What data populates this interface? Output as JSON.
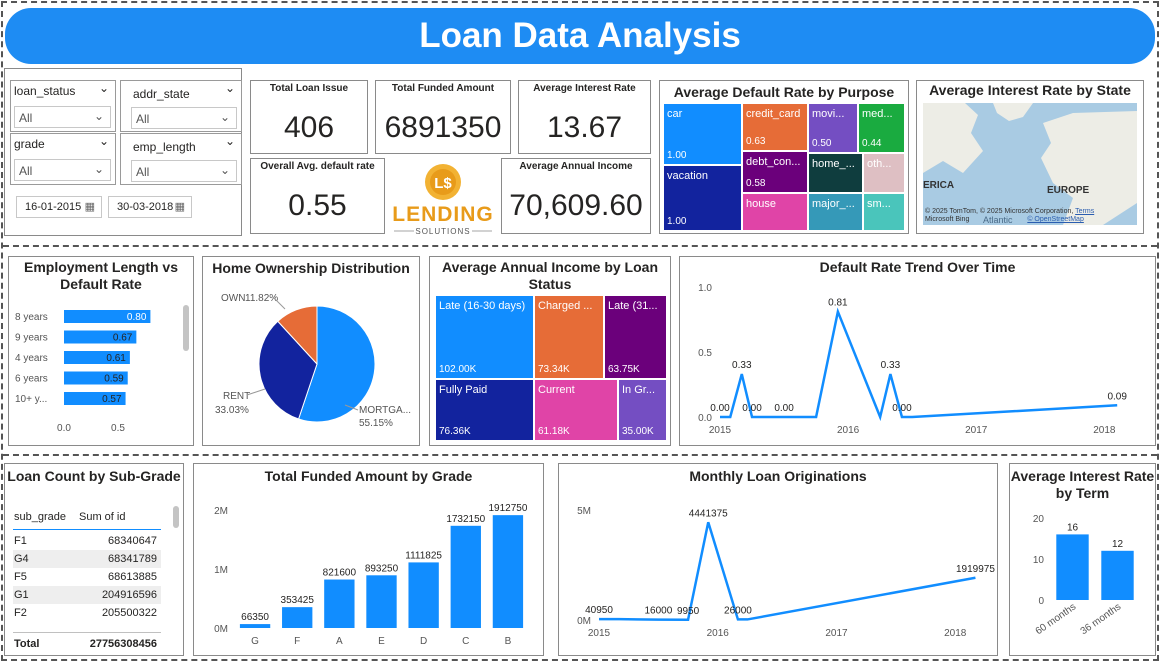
{
  "header": {
    "title": "Loan Data Analysis"
  },
  "slicers": {
    "loan_status": {
      "label": "loan_status",
      "value": "All"
    },
    "addr_state": {
      "label": "addr_state",
      "value": "All"
    },
    "grade": {
      "label": "grade",
      "value": "All"
    },
    "emp_length": {
      "label": "emp_length",
      "value": "All"
    },
    "date_from": "16-01-2015",
    "date_to": "30-03-2018"
  },
  "kpis": {
    "total_loan_issue": {
      "label": "Total Loan Issue",
      "value": "406"
    },
    "total_funded": {
      "label": "Total Funded Amount",
      "value": "6891350"
    },
    "avg_interest": {
      "label": "Average Interest Rate",
      "value": "13.67"
    },
    "overall_default": {
      "label": "Overall Avg. default rate",
      "value": "0.55"
    },
    "avg_income": {
      "label": "Average Annual Income",
      "value": "70,609.60"
    }
  },
  "logo": {
    "text": "LENDING",
    "sub": "SOLUTIONS",
    "symbol": "L$"
  },
  "map": {
    "title": "Average Interest Rate by State",
    "labels": [
      "ERICA",
      "EUROPE",
      "Atlantic"
    ],
    "attribution_1": "© 2025 TomTom, © 2025 Microsoft Corporation,",
    "attribution_link": "Terms",
    "attribution_2": "© OpenStreetMap",
    "bing": "Microsoft Bing"
  },
  "colors": {
    "accent": "#118DFF",
    "header": "#1E8CF3",
    "pie_mortgage": "#118DFF",
    "pie_rent": "#12239E",
    "pie_own": "#E66C37"
  },
  "chart_data": [
    {
      "id": "default_by_purpose",
      "type": "treemap",
      "title": "Average Default Rate by Purpose",
      "items": [
        {
          "label": "car",
          "value": "1.00",
          "color": "#118DFF"
        },
        {
          "label": "vacation",
          "value": "1.00",
          "color": "#12239E"
        },
        {
          "label": "credit_card",
          "value": "0.63",
          "color": "#E66C37"
        },
        {
          "label": "debt_con...",
          "value": "0.58",
          "color": "#6B007B"
        },
        {
          "label": "house",
          "value": "",
          "color": "#E044A7"
        },
        {
          "label": "movi...",
          "value": "0.50",
          "color": "#744EC2"
        },
        {
          "label": "med...",
          "value": "0.44",
          "color": "#1AAB40"
        },
        {
          "label": "home_...",
          "value": "",
          "color": "#0F3D3E"
        },
        {
          "label": "oth...",
          "value": "",
          "color": "#DEBFC3"
        },
        {
          "label": "major_...",
          "value": "",
          "color": "#3599B8"
        },
        {
          "label": "sm...",
          "value": "",
          "color": "#4AC5BB"
        }
      ]
    },
    {
      "id": "emp_length_default",
      "type": "bar",
      "orientation": "horizontal",
      "title": "Employment Length vs Default Rate",
      "categories": [
        "8 years",
        "9 years",
        "4 years",
        "6 years",
        "10+ y..."
      ],
      "values": [
        0.8,
        0.67,
        0.61,
        0.59,
        0.57
      ],
      "value_labels": [
        "0.80",
        "0.67",
        "0.61",
        "0.59",
        "0.57"
      ],
      "xticks": [
        "0.0",
        "0.5"
      ],
      "xlim": [
        0,
        1
      ]
    },
    {
      "id": "home_ownership",
      "type": "pie",
      "title": "Home Ownership Distribution",
      "slices": [
        {
          "label": "MORTGA...",
          "value": 55.15,
          "pct_label": "55.15%"
        },
        {
          "label": "RENT",
          "value": 33.03,
          "pct_label": "33.03%"
        },
        {
          "label": "OWN",
          "value": 11.82,
          "pct_label": "11.82%"
        }
      ]
    },
    {
      "id": "income_by_status",
      "type": "treemap",
      "title": "Average Annual Income by Loan Status",
      "items": [
        {
          "label": "Late (16-30 days)",
          "value": "102.00K",
          "color": "#118DFF"
        },
        {
          "label": "Fully Paid",
          "value": "76.36K",
          "color": "#12239E"
        },
        {
          "label": "Charged ...",
          "value": "73.34K",
          "color": "#E66C37"
        },
        {
          "label": "Current",
          "value": "61.18K",
          "color": "#E044A7"
        },
        {
          "label": "Late (31...",
          "value": "63.75K",
          "color": "#6B007B"
        },
        {
          "label": "In Gr...",
          "value": "35.00K",
          "color": "#744EC2"
        }
      ]
    },
    {
      "id": "default_trend",
      "type": "line",
      "title": "Default Rate Trend Over Time",
      "x": [
        2015.0,
        2015.08,
        2015.17,
        2015.25,
        2015.5,
        2015.75,
        2015.92,
        2016.25,
        2016.33,
        2016.42,
        2016.5,
        2018.1
      ],
      "y": [
        0.0,
        0.0,
        0.33,
        0.0,
        0.0,
        0.0,
        0.81,
        0.0,
        0.33,
        0.0,
        0.0,
        0.09
      ],
      "data_labels": [
        "0.00",
        "",
        "0.33",
        "0.00",
        "0.00",
        "",
        "0.81",
        "",
        "0.33",
        "0.00",
        "",
        "0.09"
      ],
      "yticks": [
        "0.0",
        "0.5",
        "1.0"
      ],
      "xticks": [
        "2015",
        "2016",
        "2017",
        "2018"
      ],
      "ylim": [
        0,
        1.0
      ]
    },
    {
      "id": "loan_count_subgrade",
      "type": "table",
      "title": "Loan Count by Sub-Grade",
      "columns": [
        "sub_grade",
        "Sum of id"
      ],
      "rows": [
        [
          "F1",
          "68340647"
        ],
        [
          "G4",
          "68341789"
        ],
        [
          "F5",
          "68613885"
        ],
        [
          "G1",
          "204916596"
        ],
        [
          "F2",
          "205500322"
        ]
      ],
      "total": [
        "Total",
        "27756308456"
      ]
    },
    {
      "id": "funded_by_grade",
      "type": "bar",
      "title": "Total Funded Amount by Grade",
      "categories": [
        "G",
        "F",
        "A",
        "E",
        "D",
        "C",
        "B"
      ],
      "values": [
        66350,
        353425,
        821600,
        893250,
        1111825,
        1732150,
        1912750
      ],
      "value_labels": [
        "66350",
        "353425",
        "821600",
        "893250",
        "1111825",
        "1732150",
        "1912750"
      ],
      "yticks": [
        "0M",
        "1M",
        "2M"
      ],
      "ylim": [
        0,
        2000000
      ]
    },
    {
      "id": "monthly_originations",
      "type": "line",
      "title": "Monthly Loan Originations",
      "x": [
        2015.0,
        2015.17,
        2015.5,
        2015.75,
        2015.92,
        2016.17,
        2016.25,
        2018.17
      ],
      "y": [
        40950,
        40950,
        16000,
        9950,
        4441375,
        26000,
        26000,
        1919975
      ],
      "data_labels": [
        "40950",
        "",
        "16000",
        "9950",
        "4441375",
        "26000",
        "",
        "1919975"
      ],
      "yticks": [
        "0M",
        "5M"
      ],
      "xticks": [
        "2015",
        "2016",
        "2017",
        "2018"
      ],
      "ylim": [
        0,
        5000000
      ]
    },
    {
      "id": "interest_by_term",
      "type": "bar",
      "title": "Average Interest Rate by Term",
      "categories": [
        "60 months",
        "36 months"
      ],
      "values": [
        16,
        12
      ],
      "value_labels": [
        "16",
        "12"
      ],
      "yticks": [
        "0",
        "10",
        "20"
      ],
      "ylim": [
        0,
        20
      ]
    }
  ]
}
